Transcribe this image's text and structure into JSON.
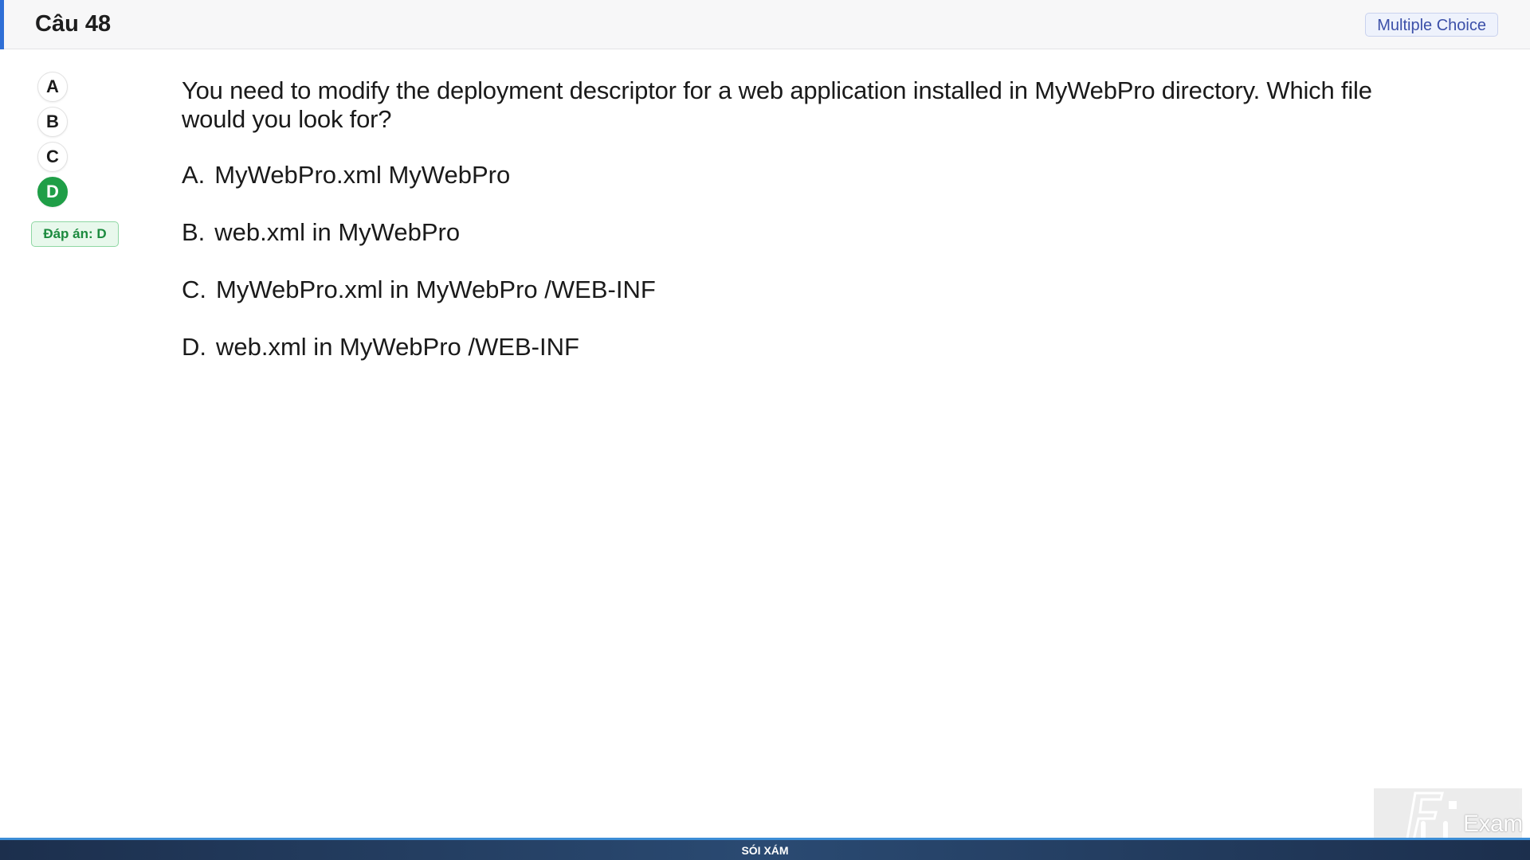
{
  "header": {
    "title": "Câu 48",
    "question_type": "Multiple Choice"
  },
  "answers": {
    "letters": [
      "A",
      "B",
      "C",
      "D"
    ],
    "selected": "D",
    "answer_label": "Đáp án: D"
  },
  "question": {
    "text": "You need to modify the deployment descriptor for a web application installed in MyWebPro directory. Which file would you look for?",
    "options": [
      {
        "letter": "A.",
        "text": "MyWebPro.xml MyWebPro"
      },
      {
        "letter": "B.",
        "text": "web.xml in MyWebPro"
      },
      {
        "letter": "C.",
        "text": "MyWebPro.xml in MyWebPro /WEB-INF"
      },
      {
        "letter": "D.",
        "text": "web.xml in MyWebPro /WEB-INF"
      }
    ]
  },
  "watermark": {
    "text": "Exam",
    "logo_icon": "fu-logo-icon"
  },
  "footer": {
    "label": "SÓI XÁM"
  },
  "colors": {
    "accent": "#2f6fd6",
    "selected_green": "#1f9e47",
    "badge_blue": "#3b4fa8",
    "footer_dark": "#1c2f4d"
  }
}
